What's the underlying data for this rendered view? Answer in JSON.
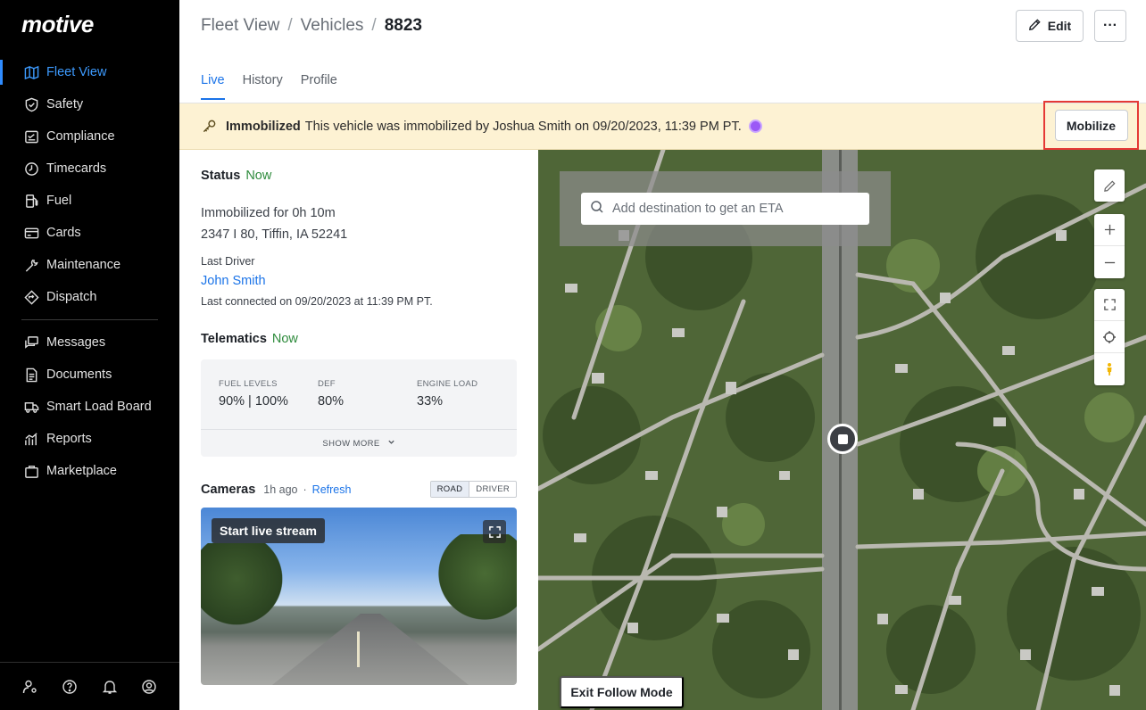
{
  "brand": {
    "logo": "motive"
  },
  "sidebar": {
    "items": [
      {
        "label": "Fleet View",
        "icon": "map-icon"
      },
      {
        "label": "Safety",
        "icon": "shield-icon"
      },
      {
        "label": "Compliance",
        "icon": "clipboard-icon"
      },
      {
        "label": "Timecards",
        "icon": "clock-icon"
      },
      {
        "label": "Fuel",
        "icon": "fuel-pump-icon"
      },
      {
        "label": "Cards",
        "icon": "card-icon"
      },
      {
        "label": "Maintenance",
        "icon": "wrench-icon"
      },
      {
        "label": "Dispatch",
        "icon": "dispatch-icon"
      }
    ],
    "items2": [
      {
        "label": "Messages",
        "icon": "chat-icon"
      },
      {
        "label": "Documents",
        "icon": "document-icon"
      },
      {
        "label": "Smart Load Board",
        "icon": "truck-icon"
      },
      {
        "label": "Reports",
        "icon": "chart-icon"
      },
      {
        "label": "Marketplace",
        "icon": "bag-icon"
      }
    ],
    "active": "Fleet View",
    "active_color": "#3d9bff"
  },
  "header": {
    "breadcrumb": [
      "Fleet View",
      "Vehicles",
      "8823"
    ],
    "separator": "/",
    "edit_label": "Edit",
    "more_label": "···",
    "tabs": [
      "Live",
      "History",
      "Profile"
    ],
    "active_tab": "Live"
  },
  "banner": {
    "title": "Immobilized",
    "message": "This vehicle was immobilized by Joshua Smith on 09/20/2023, 11:39 PM PT.",
    "action_label": "Mobilize",
    "bg_color": "#fdf2d3"
  },
  "status": {
    "title": "Status",
    "freshness": "Now",
    "line1": "Immobilized for 0h 10m",
    "line2": "2347 I 80, Tiffin, IA 52241",
    "last_driver_label": "Last Driver",
    "driver_name": "John Smith",
    "last_connected": "Last connected on 09/20/2023 at 11:39 PM PT."
  },
  "telematics": {
    "title": "Telematics",
    "freshness": "Now",
    "metrics": [
      {
        "label": "FUEL LEVELS",
        "value": "90% | 100%"
      },
      {
        "label": "DEF",
        "value": "80%"
      },
      {
        "label": "ENGINE LOAD",
        "value": "33%"
      }
    ],
    "show_more": "SHOW MORE"
  },
  "cameras": {
    "title": "Cameras",
    "age": "1h ago",
    "dot": "·",
    "refresh": "Refresh",
    "views": [
      "ROAD",
      "DRIVER"
    ],
    "active_view": "ROAD",
    "live_label": "Start live stream"
  },
  "map": {
    "search_placeholder": "Add destination to get an ETA",
    "exit_follow": "Exit Follow Mode",
    "controls": [
      "pencil-icon",
      "zoom-in-icon",
      "zoom-out-icon",
      "fullscreen-icon",
      "locate-icon",
      "street-view-icon"
    ]
  }
}
